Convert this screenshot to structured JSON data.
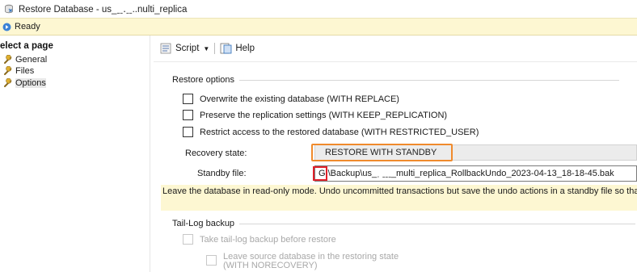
{
  "window": {
    "title": "Restore Database - us_ˍˍ․ˍˍ..nulti_replica"
  },
  "status": {
    "text": "Ready"
  },
  "left_pane": {
    "heading": "elect a page",
    "pages": [
      {
        "label": "General",
        "selected": false
      },
      {
        "label": "Files",
        "selected": false
      },
      {
        "label": "Options",
        "selected": true
      }
    ]
  },
  "toolbar": {
    "script_label": "Script",
    "help_label": "Help"
  },
  "restore_options": {
    "group_label": "Restore options",
    "checkboxes": [
      {
        "label": "Overwrite the existing database (WITH REPLACE)",
        "checked": false
      },
      {
        "label": "Preserve the replication settings (WITH KEEP_REPLICATION)",
        "checked": false
      },
      {
        "label": "Restrict access to the restored database (WITH RESTRICTED_USER)",
        "checked": false
      }
    ],
    "recovery_state_label": "Recovery state:",
    "recovery_state_value": "RESTORE WITH STANDBY",
    "standby_file_label": "Standby file:",
    "standby_file_value": "G:\\Backup\\us_ˌ  ˍˍˍ_multi_replica_RollbackUndo_2023-04-13_18-18-45.bak",
    "info_text": "Leave the database in read-only mode. Undo uncommitted transactions but save the undo actions in a standby file so that r"
  },
  "tail_log": {
    "group_label": "Tail-Log backup",
    "take_backup_label": "Take tail-log backup before restore",
    "leave_source_line1": "Leave source database in the restoring state",
    "leave_source_line2": "(WITH NORECOVERY)"
  },
  "colors": {
    "status_band": "#fdf7d2",
    "orange_highlight": "#f08a2c",
    "red_highlight": "#e0202a"
  }
}
